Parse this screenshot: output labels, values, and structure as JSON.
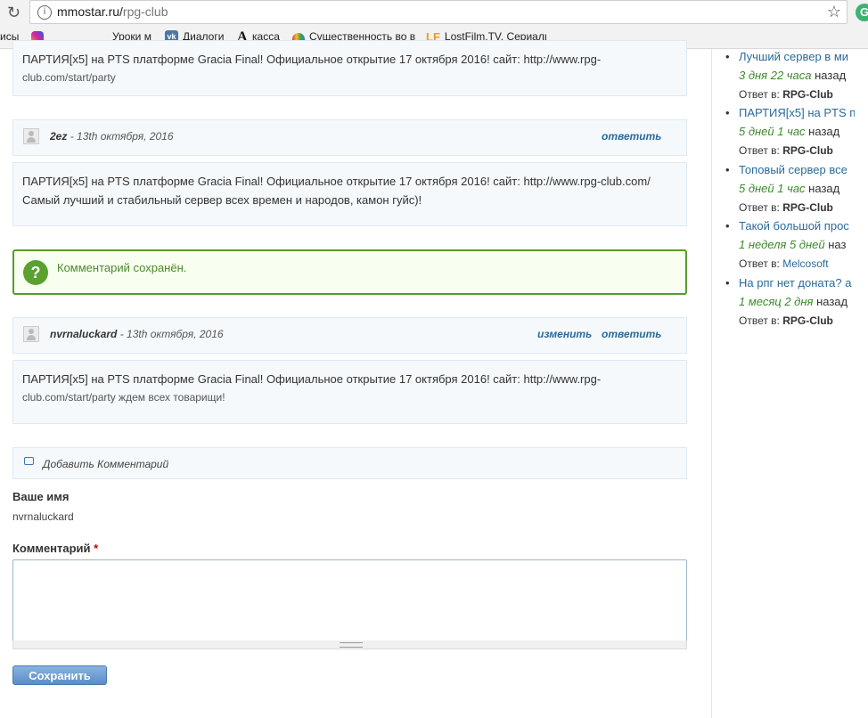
{
  "browser": {
    "url_host": "mmostar.ru/",
    "url_path": "rpg-club",
    "bookmarks": [
      {
        "label": "исы"
      },
      {
        "label": ""
      },
      {
        "label": "Уроки м"
      },
      {
        "label": "Диалоги"
      },
      {
        "label": "касса"
      },
      {
        "label": "Существенность во в"
      },
      {
        "label": "LostFilm.TV. Сериалы"
      }
    ]
  },
  "comments": [
    {
      "text_line1": "ПАРТИЯ[x5] на PTS платформе Gracia Final! Официальное открытие 17 октября 2016! сайт: http://www.rpg-",
      "text_line2": "club.com/start/party"
    },
    {
      "author": "2ez",
      "date": " - 13th октября, 2016",
      "reply_label": "ответить",
      "text_line1": "ПАРТИЯ[x5] на PTS платформе Gracia Final! Официальное открытие 17 октября 2016! сайт: http://www.rpg-club.com/",
      "text_line2": "Самый лучший и стабильный сервер всех времен и народов, камон гуйс)!"
    },
    {
      "author": "nvrnaluckard",
      "date": " - 13th октября, 2016",
      "edit_label": "изменить",
      "reply_label": "ответить",
      "text_line1": "ПАРТИЯ[x5] на PTS платформе Gracia Final! Официальное открытие 17 октября 2016! сайт: http://www.rpg-",
      "text_line2": "club.com/start/party ждем всех товарищи!"
    }
  ],
  "status_message": "Комментарий сохранён.",
  "form": {
    "section_title": "Добавить Комментарий",
    "name_label": "Ваше имя",
    "name_value": "nvrnaluckard",
    "comment_label": "Комментарий",
    "required_mark": "*",
    "save_label": "Сохранить"
  },
  "sidebar": {
    "items": [
      {
        "title": "Лучший сервер в ми",
        "age": "3 дня 22 часа",
        "ago": " назад",
        "reply_prefix": "Ответ в: ",
        "reply_to": "RPG-Club"
      },
      {
        "title": "ПАРТИЯ[x5] на PTS п",
        "age": "5 дней 1 час",
        "ago": " назад",
        "reply_prefix": "Ответ в: ",
        "reply_to": "RPG-Club"
      },
      {
        "title": "Топовый сервер все",
        "age": "5 дней 1 час",
        "ago": " назад",
        "reply_prefix": "Ответ в: ",
        "reply_to": "RPG-Club"
      },
      {
        "title": "Такой большой прос",
        "age": "1 неделя 5 дней",
        "ago": " наз",
        "reply_prefix": "Ответ в: ",
        "reply_to": "Melcosoft"
      },
      {
        "title": "На рпг нет доната? а",
        "age": "1 месяц 2 дня",
        "ago": " назад",
        "reply_prefix": "Ответ в: ",
        "reply_to": "RPG-Club"
      }
    ]
  }
}
